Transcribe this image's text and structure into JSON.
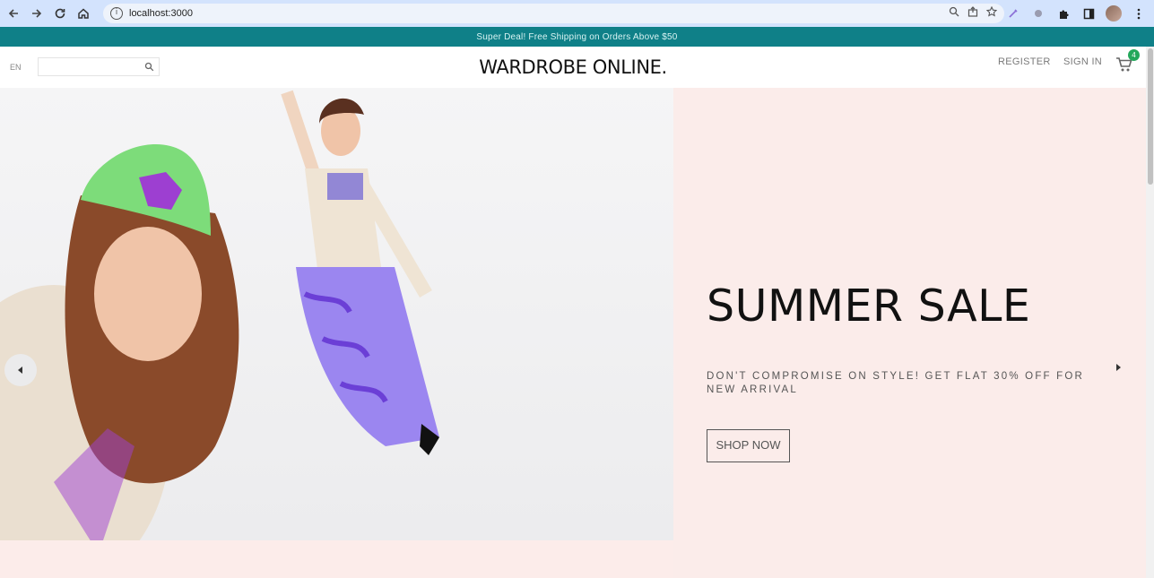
{
  "browser": {
    "url": "localhost:3000",
    "nav_icons": [
      "back-icon",
      "forward-icon",
      "reload-icon",
      "home-icon"
    ]
  },
  "promo": {
    "text": "Super Deal! Free Shipping on Orders Above $50"
  },
  "header": {
    "language": "EN",
    "search_placeholder": "",
    "logo": "WARDROBE ONLINE.",
    "register": "REGISTER",
    "sign_in": "SIGN IN",
    "cart_count": "4"
  },
  "hero": {
    "title": "SUMMER SALE",
    "subtitle": "DON'T COMPROMISE ON STYLE! GET FLAT 30% OFF FOR NEW ARRIVAL",
    "button": "SHOP NOW",
    "background_color": "#fbecea"
  },
  "colors": {
    "promo_bar": "#0f8088",
    "cart_badge": "#23a85b",
    "chrome": "#d3e3fd"
  }
}
